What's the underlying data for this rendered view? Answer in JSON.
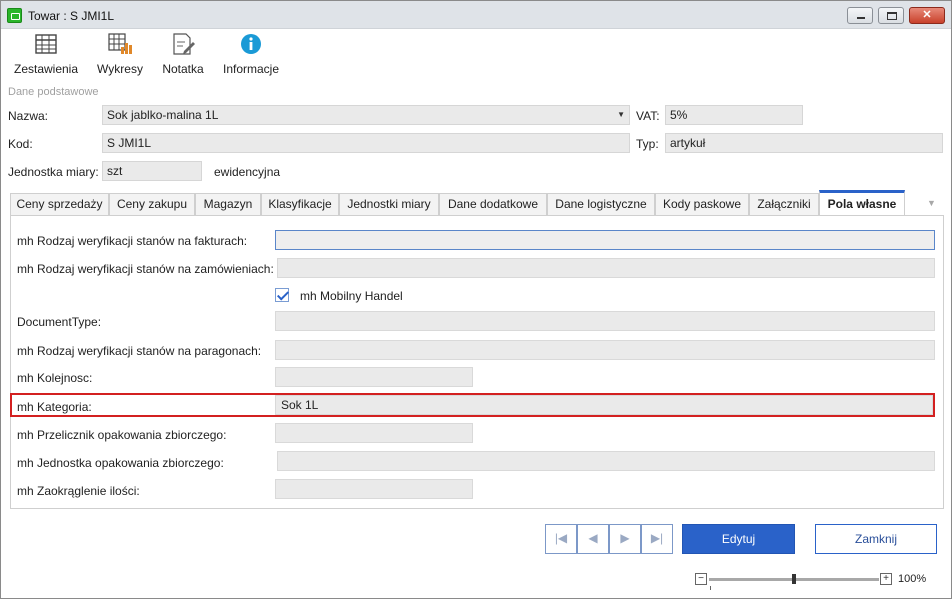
{
  "window": {
    "title": "Towar : S JMI1L"
  },
  "toolbar": {
    "items": [
      {
        "label": "Zestawienia",
        "icon": "table-icon"
      },
      {
        "label": "Wykresy",
        "icon": "chart-table-icon"
      },
      {
        "label": "Notatka",
        "icon": "note-icon"
      },
      {
        "label": "Informacje",
        "icon": "info-icon"
      }
    ]
  },
  "basic": {
    "section_label": "Dane podstawowe",
    "name_label": "Nazwa:",
    "name_value": "Sok jablko-malina 1L",
    "vat_label": "VAT:",
    "vat_value": "5%",
    "code_label": "Kod:",
    "code_value": "S JMI1L",
    "type_label": "Typ:",
    "type_value": "artykuł",
    "unit_label": "Jednostka miary:",
    "unit_value": "szt",
    "unit_note": "ewidencyjna"
  },
  "tabs": [
    {
      "label": "Ceny sprzedaży",
      "active": false
    },
    {
      "label": "Ceny zakupu",
      "active": false
    },
    {
      "label": "Magazyn",
      "active": false
    },
    {
      "label": "Klasyfikacje",
      "active": false
    },
    {
      "label": "Jednostki miary",
      "active": false
    },
    {
      "label": "Dane dodatkowe",
      "active": false
    },
    {
      "label": "Dane logistyczne",
      "active": false
    },
    {
      "label": "Kody paskowe",
      "active": false
    },
    {
      "label": "Załączniki",
      "active": false
    },
    {
      "label": "Pola własne",
      "active": true
    }
  ],
  "custom_fields": {
    "rows": [
      {
        "label": "mh Rodzaj weryfikacji stanów na fakturach:",
        "value": ""
      },
      {
        "label": "mh Rodzaj weryfikacji stanów na zamówieniach:",
        "value": ""
      },
      {
        "label": "DocumentType:",
        "value": ""
      },
      {
        "label": "mh Rodzaj weryfikacji stanów na paragonach:",
        "value": ""
      },
      {
        "label": "mh Kolejnosc:",
        "value": ""
      },
      {
        "label": "mh Kategoria:",
        "value": "Sok 1L"
      },
      {
        "label": "mh Przelicznik opakowania zbiorczego:",
        "value": ""
      },
      {
        "label": "mh Jednostka opakowania zbiorczego:",
        "value": ""
      },
      {
        "label": "mh Zaokrąglenie ilości:",
        "value": ""
      }
    ],
    "checkbox": {
      "label": "mh Mobilny Handel",
      "checked": true
    }
  },
  "actions": {
    "edit_label": "Edytuj",
    "close_label": "Zamknij"
  },
  "zoom": {
    "value": "100%",
    "minus": "−",
    "plus": "+"
  },
  "colors": {
    "accent": "#2a62c9",
    "highlight": "#d32020",
    "field_bg": "#eaeaea"
  }
}
